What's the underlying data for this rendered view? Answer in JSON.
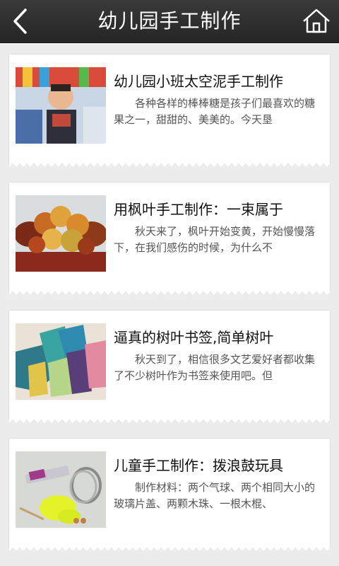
{
  "header": {
    "title": "幼儿园手工制作"
  },
  "articles": [
    {
      "title": "幼儿园小班太空泥手工制作",
      "summary": "各种各样的棒棒糖是孩子们最喜欢的糖果之一，甜甜的、美美的。今天垦"
    },
    {
      "title": "用枫叶手工制作：一束属于",
      "summary": "秋天来了，枫叶开始变黄，开始慢慢落下，在我们感伤的时候，为什么不"
    },
    {
      "title": "逼真的树叶书签,简单树叶",
      "summary": "秋天到了，相信很多文艺爱好者都收集了不少树叶作为书签来使用吧。但"
    },
    {
      "title": "儿童手工制作：拨浪鼓玩具",
      "summary": "制作材料：两个气球、两个相同大小的玻璃片盖、两颗木珠、一根木棍、"
    }
  ]
}
